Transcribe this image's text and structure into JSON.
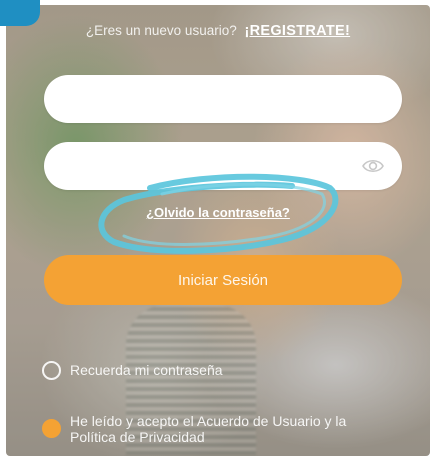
{
  "signup": {
    "prompt": "¿Eres un nuevo usuario?",
    "link": "¡REGISTRATE!"
  },
  "form": {
    "username_value": "",
    "username_placeholder": "",
    "password_value": "",
    "password_placeholder": "",
    "show_password_icon": "eye-icon",
    "forgot_password": "¿Olvido la contraseña?",
    "login_button": "Iniciar Sesión"
  },
  "options": {
    "remember_label": "Recuerda mi contraseña",
    "remember_checked": false,
    "terms_label": "He leído y acepto el Acuerdo de Usuario y la Política de Privacidad",
    "terms_checked": true
  },
  "colors": {
    "accent": "#f4a234",
    "corner_badge": "#1f8fc2",
    "highlight_scribble": "#5bc6dc"
  }
}
